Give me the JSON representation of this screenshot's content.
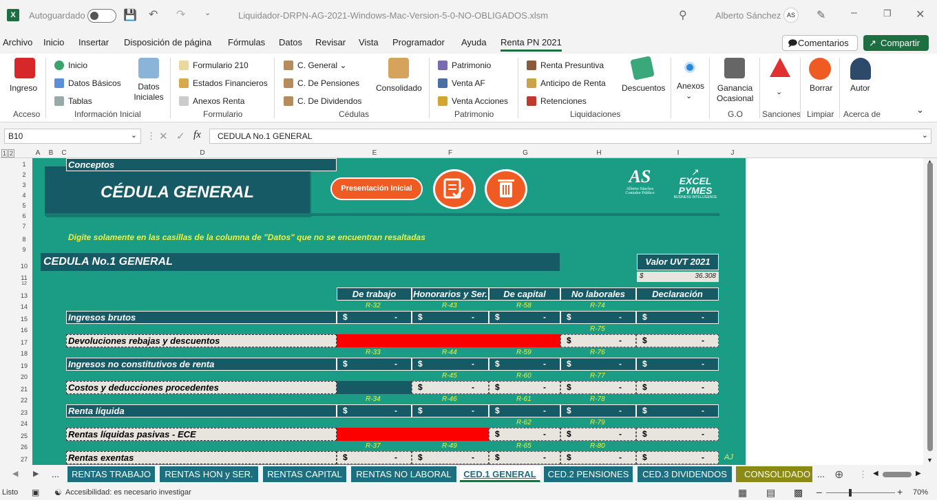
{
  "titlebar": {
    "autosave_label": "Autoguardado",
    "filename": "Liquidador-DRPN-AG-2021-Windows-Mac-Version-5-0-NO-OBLIGADOS.xlsm",
    "user": "Alberto Sánchez",
    "user_initials": "AS"
  },
  "menu": [
    "Archivo",
    "Inicio",
    "Insertar",
    "Disposición de página",
    "Fórmulas",
    "Datos",
    "Revisar",
    "Vista",
    "Programador",
    "Ayuda",
    "Renta PN 2021"
  ],
  "actions": {
    "comments": "Comentarios",
    "share": "Compartir"
  },
  "ribbon": {
    "ingreso": "Ingreso",
    "inicio": "Inicio",
    "datos_basicos": "Datos Básicos",
    "tablas": "Tablas",
    "datos_iniciales": "Datos Iniciales",
    "formulario_210": "Formulario 210",
    "estados_financieros": "Estados Financieros",
    "anexos_renta": "Anexos Renta",
    "c_general": "C. General",
    "c_pensiones": "C. De Pensiones",
    "c_dividendos": "C. De Dividendos",
    "consolidado": "Consolidado",
    "patrimonio": "Patrimonio",
    "venta_af": "Venta AF",
    "venta_acciones": "Venta Acciones",
    "renta_presuntiva": "Renta Presuntiva",
    "anticipo_renta": "Anticipo de Renta",
    "retenciones": "Retenciones",
    "descuentos": "Descuentos",
    "anexos": "Anexos",
    "ganancia_ocasional": "Ganancia Ocasional",
    "borrar": "Borrar",
    "autor": "Autor",
    "groups": {
      "acceso": "Acceso",
      "informacion_inicial": "Información Inicial",
      "formulario": "Formulario",
      "cedulas": "Cédulas",
      "patrimonio": "Patrimonio",
      "liquidaciones": "Liquidaciones",
      "go": "G.O",
      "sanciones": "Sanciones",
      "limpiar": "Limpiar",
      "acerca_de": "Acerca de"
    }
  },
  "formula_bar": {
    "cell_ref": "B10",
    "fx": "fx",
    "content": "CEDULA No.1 GENERAL"
  },
  "columns": [
    "A",
    "B",
    "C",
    "D",
    "E",
    "F",
    "G",
    "H",
    "I",
    "J"
  ],
  "rows": [
    "1",
    "2",
    "3",
    "4",
    "5",
    "6",
    "7",
    "8",
    "9",
    "10",
    "11",
    "12",
    "13",
    "14",
    "15",
    "16",
    "17",
    "18",
    "19",
    "20",
    "21",
    "22",
    "23",
    "24",
    "25",
    "26",
    "27"
  ],
  "sheet": {
    "title": "CÉDULA GENERAL",
    "presentation_button": "Presentación Inicial",
    "brand1_name": "Alberto Sánchez",
    "brand1_sub": "Contador Público",
    "brand2_a": "EXCEL",
    "brand2_b": "PYMES",
    "brand2_sub": "BUSINESS INTELLIGENCE",
    "instruction": "Digite solamente en las casillas de la columna de \"Datos\" que no se encuentran resaltadas",
    "cedula_title": "CEDULA No.1 GENERAL",
    "uvt_label": "Valor UVT 2021",
    "uvt_currency": "$",
    "uvt_value": "36.308",
    "headers": [
      "Conceptos",
      "De trabajo",
      "Honorarios y Ser.",
      "De capital",
      "No laborales",
      "Declaración"
    ],
    "currency": "$",
    "dash": "-",
    "refs": {
      "r14": [
        "R-32",
        "R-43",
        "R-58",
        "R-74"
      ],
      "r16": [
        "R-75"
      ],
      "r18": [
        "R-33",
        "R-44",
        "R-59",
        "R-76"
      ],
      "r20": [
        "R-45",
        "R-60",
        "R-77"
      ],
      "r22": [
        "R-34",
        "R-46",
        "R-61",
        "R-78"
      ],
      "r24": [
        "R-62",
        "R-79"
      ],
      "r26": [
        "R-37",
        "R-49",
        "R-65",
        "R-80"
      ]
    },
    "row_labels": [
      "Ingresos brutos",
      "Devoluciones rebajas y descuentos",
      "Ingresos no constitutivos de renta",
      "Costos y deducciones procedentes",
      "Renta líquida",
      "Rentas líquidas pasivas - ECE",
      "Rentas exentas"
    ],
    "side_mark": "AJ"
  },
  "tabs": [
    "RENTAS TRABAJO",
    "RENTAS HON y SER.",
    "RENTAS CAPITAL",
    "RENTAS NO LABORAL",
    "CED.1 GENERAL",
    "CED.2 PENSIONES",
    "CED.3 DIVIDENDOS",
    "CONSOLIDADO R"
  ],
  "tab_more": "...",
  "status": {
    "ready": "Listo",
    "accessibility": "Accesibilidad: es necesario investigar",
    "zoom": "70%"
  }
}
